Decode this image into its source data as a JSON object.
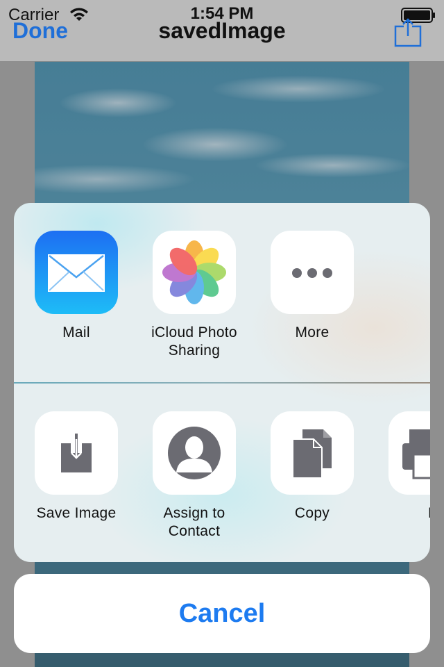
{
  "status_bar": {
    "carrier": "Carrier",
    "time": "1:54 PM",
    "icons": [
      "wifi-icon",
      "battery-icon"
    ]
  },
  "nav": {
    "done_label": "Done",
    "title": "savedImage",
    "share_icon": "share-icon"
  },
  "share_sheet": {
    "apps": [
      {
        "label": "Mail",
        "icon": "mail-icon"
      },
      {
        "label": "iCloud Photo Sharing",
        "icon": "photos-icon"
      },
      {
        "label": "More",
        "icon": "more-icon"
      }
    ],
    "actions": [
      {
        "label": "Save Image",
        "icon": "save-image-icon"
      },
      {
        "label": "Assign to Contact",
        "icon": "contact-icon"
      },
      {
        "label": "Copy",
        "icon": "copy-icon"
      },
      {
        "label": "Pr",
        "icon": "print-icon"
      }
    ],
    "cancel_label": "Cancel"
  },
  "colors": {
    "accent": "#1d7bf0",
    "glyph": "#6b6b72",
    "mail_gradient": [
      "#1d6ff2",
      "#1ebcf7"
    ]
  }
}
